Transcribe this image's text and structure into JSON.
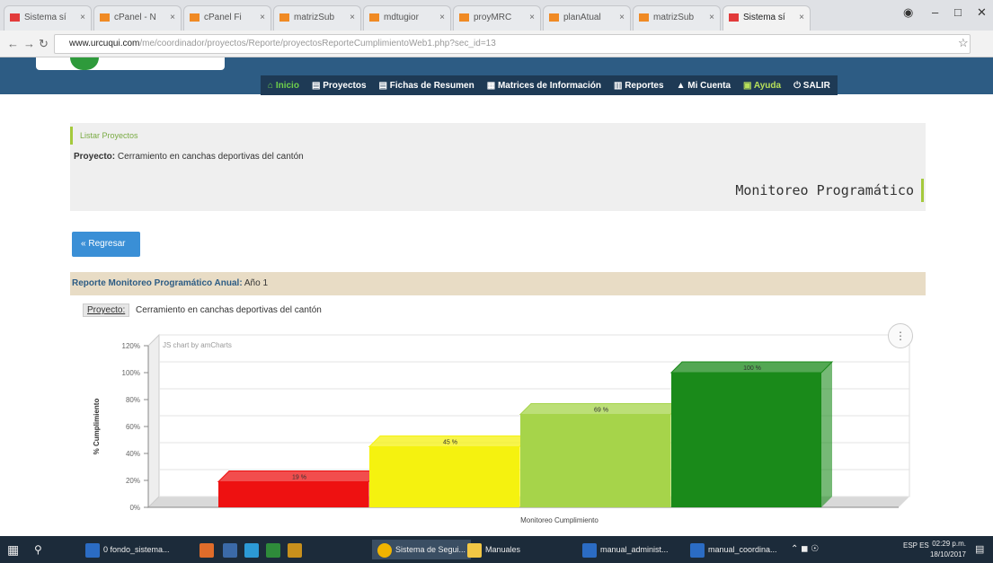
{
  "browser": {
    "tabs": [
      {
        "label": "Sistema sí",
        "active": false
      },
      {
        "label": "cPanel - N",
        "active": false
      },
      {
        "label": "cPanel Fi",
        "active": false
      },
      {
        "label": "matrizSub",
        "active": false
      },
      {
        "label": "mdtugior",
        "active": false
      },
      {
        "label": "proyMRC",
        "active": false
      },
      {
        "label": "planAtual",
        "active": false
      },
      {
        "label": "matrizSub",
        "active": false
      },
      {
        "label": "Sistema sí",
        "active": true
      }
    ],
    "url_host": "www.urcuqui.com",
    "url_path": "/me/coordinador/proyectos/Reporte/proyectosReporteCumplimientoWeb1.php?sec_id=13"
  },
  "menu": {
    "items": [
      {
        "label": "Inicio",
        "icon": "home-icon"
      },
      {
        "label": "Proyectos",
        "icon": "book-icon"
      },
      {
        "label": "Fichas de Resumen",
        "icon": "book-icon"
      },
      {
        "label": "Matrices de Información",
        "icon": "table-icon"
      },
      {
        "label": "Reportes",
        "icon": "report-icon"
      },
      {
        "label": "Mi Cuenta",
        "icon": "user-icon"
      },
      {
        "label": "Ayuda",
        "icon": "help-icon"
      },
      {
        "label": "SALIR",
        "icon": "power-icon"
      }
    ]
  },
  "breadcrumb": "Listar Proyectos",
  "project": {
    "label": "Proyecto:",
    "name": "Cerramiento en canchas deportivas del cantón"
  },
  "page_title": "Monitoreo Programático",
  "back_button": "Regresar",
  "report": {
    "title": "Reporte Monitoreo Programático Anual:",
    "year": "Año 1",
    "project_tag": "Proyecto:",
    "project_name": "Cerramiento en canchas deportivas del cantón"
  },
  "chart_data": {
    "type": "bar",
    "watermark": "JS chart by amCharts",
    "xlabel": "Monitoreo Cumplimiento",
    "ylabel": "% Cumplimiento",
    "ylim": [
      0,
      120
    ],
    "yticks": [
      "0%",
      "20%",
      "40%",
      "60%",
      "80%",
      "100%",
      "120%"
    ],
    "grid": true,
    "categories": [
      "",
      "",
      "",
      ""
    ],
    "values": [
      19,
      45,
      69,
      100
    ],
    "labels": [
      "19 %",
      "45 %",
      "69 %",
      "100 %"
    ],
    "colors": [
      "#ee1111",
      "#f5f20f",
      "#a6d44a",
      "#1a8a1a"
    ]
  },
  "taskbar": {
    "items": [
      "0 fondo_sistema...",
      "Sistema de Segui...",
      "Manuales",
      "manual_administ...",
      "manual_coordina..."
    ],
    "clock_time": "02:29 p.m.",
    "clock_date": "18/10/2017",
    "lang": "ESP ES"
  }
}
